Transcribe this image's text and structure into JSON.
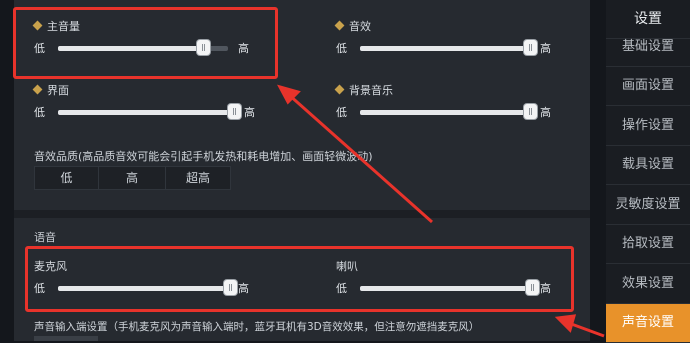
{
  "sliders": {
    "master_volume": {
      "label": "主音量",
      "low": "低",
      "high": "高",
      "value": 0.85
    },
    "sfx": {
      "label": "音效",
      "low": "低",
      "high": "高",
      "value": 1.0
    },
    "interface": {
      "label": "界面",
      "low": "低",
      "high": "高",
      "value": 1.0
    },
    "background_music": {
      "label": "背景音乐",
      "low": "低",
      "high": "高",
      "value": 1.0
    }
  },
  "quality": {
    "label": "音效品质(高品质音效可能会引起手机发热和耗电增加、画面轻微波动)",
    "options": [
      "低",
      "高",
      "超高"
    ],
    "selected": "高"
  },
  "voice": {
    "section_title": "语音",
    "microphone": {
      "label": "麦克风",
      "low": "低",
      "high": "高",
      "value": 1.0
    },
    "speaker": {
      "label": "喇叭",
      "low": "低",
      "high": "高",
      "value": 1.0
    }
  },
  "input_settings": {
    "label": "声音输入端设置（手机麦克风为声音输入端时，蓝牙耳机有3D音效效果，但注意勿遮挡麦克风）"
  },
  "sidebar": {
    "header": "设置",
    "items": [
      "基础设置",
      "画面设置",
      "操作设置",
      "载具设置",
      "灵敏度设置",
      "拾取设置",
      "效果设置",
      "声音设置"
    ],
    "active": "声音设置"
  },
  "colors": {
    "accent": "#e8922a",
    "highlight": "#e8332b",
    "slider_fill": "#e6e8ea"
  },
  "icons": {
    "slider_marker": "diamond-icon"
  }
}
